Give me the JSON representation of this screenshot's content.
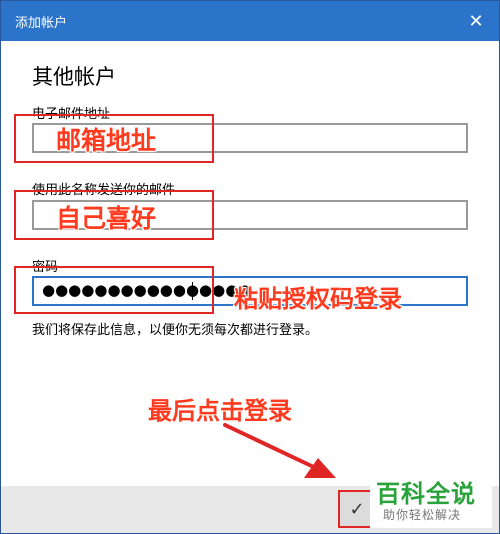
{
  "window": {
    "title": "添加帐户",
    "close_glyph": "✕"
  },
  "form": {
    "heading": "其他帐户",
    "email": {
      "label": "电子邮件地址",
      "value": ""
    },
    "sender_name": {
      "label": "使用此名称发送你的邮件",
      "value": ""
    },
    "password": {
      "label": "密码",
      "value": "●●●●●●●●●●●●●●●●"
    },
    "note": "我们将保存此信息，以便你无须每次都进行登录。"
  },
  "annotations": {
    "email": "邮箱地址",
    "name": "自己喜好",
    "password": "粘贴授权码登录",
    "login": "最后点击登录"
  },
  "footer": {
    "confirm_glyph": "✓"
  },
  "watermark": {
    "main": "百科全说",
    "sub": "助你轻松解决"
  },
  "colors": {
    "titlebar": "#2b74c9",
    "annotation": "#ff3b1f",
    "watermark": "#2ba33b"
  }
}
